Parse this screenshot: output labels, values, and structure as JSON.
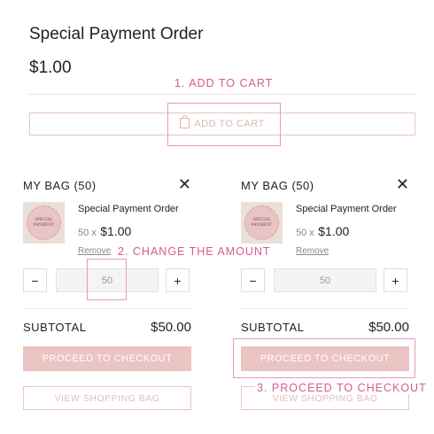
{
  "product": {
    "title": "Special Payment Order",
    "price": "$1.00",
    "add_to_cart_label": "ADD TO CART"
  },
  "annotations": {
    "step1": "1. ADD TO CART",
    "step2": "2. CHANGE THE AMOUNT",
    "step3": "3. PROCEED TO CHECKOUT"
  },
  "colors": {
    "accent_pink": "#d65a8e",
    "button_pink": "#ebc4c4",
    "highlight_pink": "#e79ab8"
  },
  "bags": [
    {
      "title": "MY BAG (50)",
      "close_icon": "close-icon",
      "thumb_text_1": "SPECIAL",
      "thumb_text_2": "PAYMENT",
      "item_name": "Special Payment Order",
      "qty_prefix": "50 x",
      "unit_price": "$1.00",
      "remove_label": "Remove",
      "minus": "−",
      "plus": "+",
      "quantity": "50",
      "subtotal_label": "SUBTOTAL",
      "subtotal_value": "$50.00",
      "checkout_label": "PROCEED TO CHECKOUT",
      "view_bag_label": "VIEW SHOPPING BAG"
    },
    {
      "title": "MY BAG (50)",
      "close_icon": "close-icon",
      "thumb_text_1": "SPECIAL",
      "thumb_text_2": "PAYMENT",
      "item_name": "Special Payment Order",
      "qty_prefix": "50 x",
      "unit_price": "$1.00",
      "remove_label": "Remove",
      "minus": "−",
      "plus": "+",
      "quantity": "50",
      "subtotal_label": "SUBTOTAL",
      "subtotal_value": "$50.00",
      "checkout_label": "PROCEED TO CHECKOUT",
      "view_bag_label": "VIEW SHOPPING BAG"
    }
  ]
}
